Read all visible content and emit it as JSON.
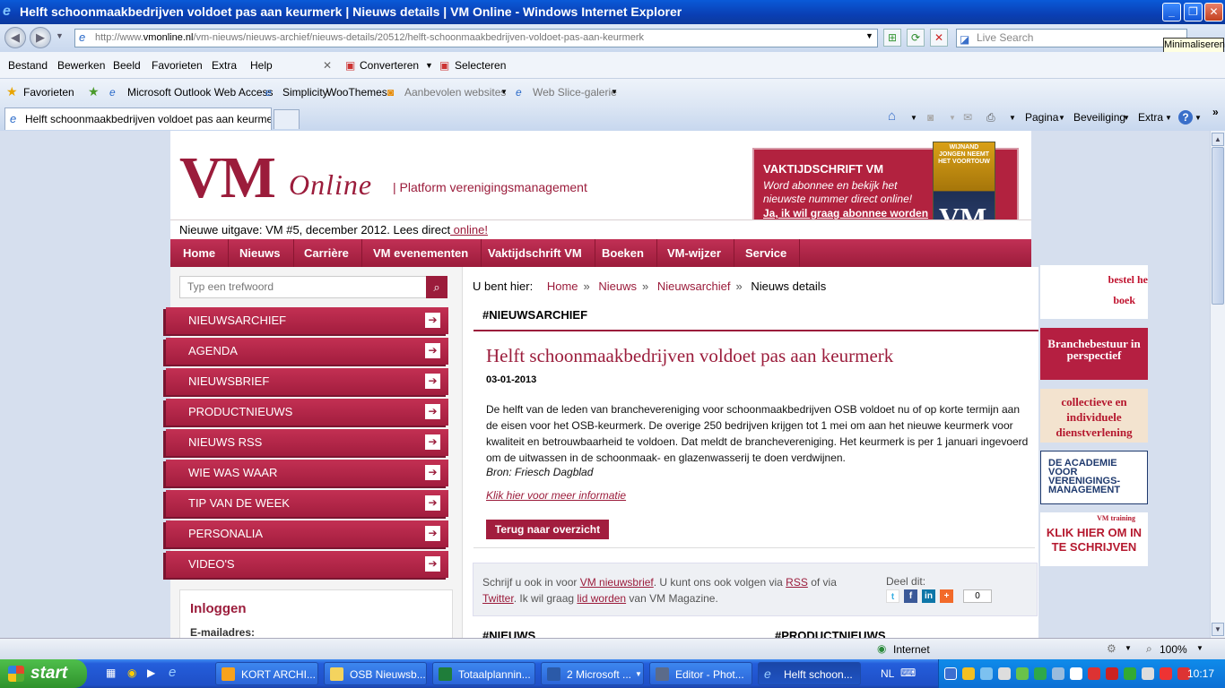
{
  "window": {
    "title": "Helft schoonmaakbedrijven voldoet pas aan keurmerk | Nieuws details | VM Online - Windows Internet Explorer",
    "tooltip": "Minimaliseren"
  },
  "address": {
    "url_prefix": "http://www.",
    "url_domain": "vmonline.nl",
    "url_path": "/vm-nieuws/nieuws-archief/nieuws-details/20512/helft-schoonmaakbedrijven-voldoet-pas-aan-keurmerk",
    "search_placeholder": "Live Search"
  },
  "menu": {
    "items": [
      "Bestand",
      "Bewerken",
      "Beeld",
      "Favorieten",
      "Extra",
      "Help"
    ],
    "convert": "Converteren",
    "select": "Selecteren"
  },
  "favbar": {
    "favorites": "Favorieten",
    "items": [
      "Microsoft Outlook Web Access",
      "Simplicity",
      "WooThemes",
      "Aanbevolen websites",
      "Web Slice-galerie"
    ]
  },
  "tabs": {
    "active": "Helft schoonmaakbedrijven voldoet pas aan keurmerk...",
    "commands": [
      "Pagina",
      "Beveiliging",
      "Extra"
    ]
  },
  "site": {
    "logo_vm": "VM",
    "logo_online": "Online",
    "tagline": "|  Platform verenigingsmanagement",
    "promo": {
      "title": "VAKTIJDSCHRIFT VM",
      "body": "Word abonnee en bekijk het nieuwste nummer direct online!",
      "link": "Ja, ik wil graag abonnee worden",
      "cover_text": "WIJNAND JONGEN NEEMT HET VOORTOUW",
      "cover_logo": "VM"
    },
    "issue": {
      "text": "Nieuwe uitgave: VM #5, december 2012. Lees direct",
      "link": " online!"
    },
    "nav": [
      "Home",
      "Nieuws",
      "Carrière",
      "VM evenementen",
      "Vaktijdschrift VM",
      "Boeken",
      "VM-wijzer",
      "Service"
    ],
    "search_placeholder": "Typ een trefwoord",
    "sidebar": [
      "NIEUWSARCHIEF",
      "AGENDA",
      "NIEUWSBRIEF",
      "PRODUCTNIEUWS",
      "NIEUWS RSS",
      "WIE WAS WAAR",
      "TIP VAN DE WEEK",
      "PERSONALIA",
      "VIDEO'S"
    ],
    "login": {
      "title": "Inloggen",
      "email_label": "E-mailadres:"
    },
    "breadcrumb": {
      "prefix": "U bent hier:",
      "items": [
        "Home",
        "Nieuws",
        "Nieuwsarchief"
      ],
      "current": "Nieuws details"
    },
    "section": "#NIEUWSARCHIEF",
    "article": {
      "title": "Helft schoonmaakbedrijven voldoet pas aan keurmerk",
      "date": "03-01-2013",
      "body": "De helft van de leden van branchevereniging voor schoonmaakbedrijven OSB voldoet nu of op korte termijn aan de eisen voor het OSB-keurmerk. De overige 250 bedrijven krijgen tot 1 mei om aan het nieuwe keurmerk voor kwaliteit en betrouwbaarheid te voldoen. Dat meldt de branchevereniging. Het keurmerk is per 1 januari ingevoerd om de uitwassen in de schoonmaak- en glazenwasserij te doen verdwijnen.",
      "source": "Bron: Friesch Dagblad",
      "more_link": "Klik hier voor meer informatie",
      "back": "Terug naar overzicht"
    },
    "subscribe": {
      "t1": "Schrijf u ook in voor ",
      "l1": "VM nieuwsbrief",
      "t2": ". U kunt ons ook volgen via ",
      "l2": "RSS",
      "t3": " of via ",
      "l3": "Twitter",
      "t4": ". Ik wil graag ",
      "l4": "lid worden",
      "t5": " van VM Magazine."
    },
    "share": {
      "label": "Deel dit:",
      "count": "0"
    },
    "bottom_heads": [
      "#NIEUWS",
      "#PRODUCTNIEUWS"
    ],
    "ads": {
      "ad1": [
        "bestel he",
        "boek"
      ],
      "ad2": "Branchebestuur in perspectief",
      "ad3": "collectieve en individuele dienstverlening",
      "ad4": [
        "DE ACADEMIE",
        "VOOR",
        "VERENIGINGS-",
        "MANAGEMENT"
      ],
      "ad5_small": "VM training",
      "ad5": "KLIK HIER OM IN TE SCHRIJVEN"
    }
  },
  "statusbar": {
    "zone": "Internet",
    "zoom": "100%"
  },
  "taskbar": {
    "start": "start",
    "tasks": [
      "KORT ARCHI...",
      "OSB Nieuwsb...",
      "Totaalplannin...",
      "2 Microsoft ...",
      "Editor - Phot...",
      "Helft schoon..."
    ],
    "lang": "NL",
    "clock": "10:17"
  },
  "colors": {
    "brand": "#9b1c3b",
    "xp_blue": "#245edb",
    "start_green": "#3aa537"
  }
}
